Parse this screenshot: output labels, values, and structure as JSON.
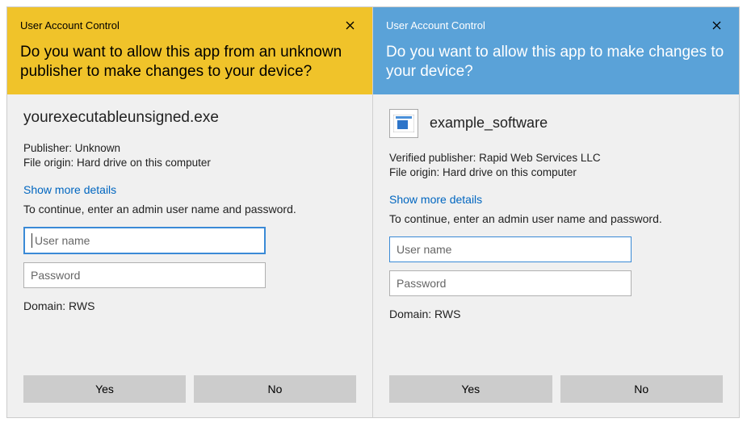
{
  "left": {
    "title": "User Account Control",
    "headline": "Do you want to allow this app from an unknown publisher to make changes to your device?",
    "app_name": "yourexecutableunsigned.exe",
    "publisher": "Publisher: Unknown",
    "origin": "File origin: Hard drive on this computer",
    "link": "Show more details",
    "instruction": "To continue, enter an admin user name and password.",
    "user_placeholder": "User name",
    "pass_placeholder": "Password",
    "domain": "Domain: RWS",
    "yes": "Yes",
    "no": "No"
  },
  "right": {
    "title": "User Account Control",
    "headline": "Do you want to allow this app to make changes to your device?",
    "app_name": "example_software",
    "publisher": "Verified publisher: Rapid Web Services LLC",
    "origin": "File origin: Hard drive on this computer",
    "link": "Show more details",
    "instruction": "To continue, enter an admin user name and password.",
    "user_placeholder": "User name",
    "pass_placeholder": "Password",
    "domain": "Domain: RWS",
    "yes": "Yes",
    "no": "No"
  }
}
